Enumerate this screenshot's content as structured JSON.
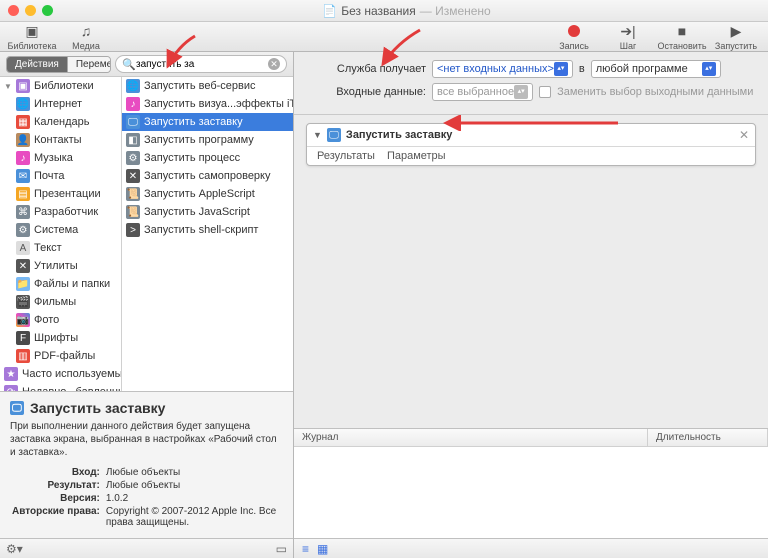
{
  "window": {
    "title": "Без названия",
    "modified": "— Изменено",
    "doc_icon": "📄"
  },
  "toolbar": {
    "left": [
      {
        "name": "library-button",
        "icon": "▣",
        "label": "Библиотека"
      },
      {
        "name": "media-button",
        "icon": "♫",
        "label": "Медиа"
      }
    ],
    "right": [
      {
        "name": "record-button",
        "icon": "●",
        "label": "Запись",
        "red": true
      },
      {
        "name": "step-button",
        "icon": "➔|",
        "label": "Шаг"
      },
      {
        "name": "stop-button",
        "icon": "■",
        "label": "Остановить"
      },
      {
        "name": "run-button",
        "icon": "▶",
        "label": "Запустить"
      }
    ]
  },
  "segments": {
    "actions": "Действия",
    "variables": "Переменные"
  },
  "search": {
    "icon": "🔍",
    "value": "запустить за"
  },
  "categories_header": "Библиотеки",
  "categories": [
    {
      "label": "Интернет",
      "ic": "i-globe",
      "g": "🌐"
    },
    {
      "label": "Календарь",
      "ic": "i-cal",
      "g": "▦"
    },
    {
      "label": "Контакты",
      "ic": "i-cont",
      "g": "👤"
    },
    {
      "label": "Музыка",
      "ic": "i-music",
      "g": "♪"
    },
    {
      "label": "Почта",
      "ic": "i-mail",
      "g": "✉"
    },
    {
      "label": "Презентации",
      "ic": "i-pres",
      "g": "▤"
    },
    {
      "label": "Разработчик",
      "ic": "i-dev",
      "g": "⌘"
    },
    {
      "label": "Система",
      "ic": "i-sys",
      "g": "⚙"
    },
    {
      "label": "Текст",
      "ic": "i-text",
      "g": "A"
    },
    {
      "label": "Утилиты",
      "ic": "i-util",
      "g": "✕"
    },
    {
      "label": "Файлы и папки",
      "ic": "i-folder",
      "g": "📁"
    },
    {
      "label": "Фильмы",
      "ic": "i-film",
      "g": "🎬"
    },
    {
      "label": "Фото",
      "ic": "i-photo",
      "g": "📷"
    },
    {
      "label": "Шрифты",
      "ic": "i-font",
      "g": "F"
    },
    {
      "label": "PDF-файлы",
      "ic": "i-pdf",
      "g": "▥"
    }
  ],
  "categories_footer": [
    {
      "label": "Часто используемые",
      "ic": "i-recent",
      "g": "★"
    },
    {
      "label": "Недавно...бавленные",
      "ic": "i-recent",
      "g": "⟳"
    }
  ],
  "actions": [
    {
      "label": "Запустить веб-сервис",
      "ic": "i-globe",
      "g": "🌐"
    },
    {
      "label": "Запустить визуа...эффекты iTunes",
      "ic": "i-music",
      "g": "♪"
    },
    {
      "label": "Запустить заставку",
      "ic": "i-ss",
      "g": "🖵",
      "sel": true
    },
    {
      "label": "Запустить программу",
      "ic": "i-app",
      "g": "◧"
    },
    {
      "label": "Запустить процесс",
      "ic": "i-dev",
      "g": "⚙"
    },
    {
      "label": "Запустить самопроверку",
      "ic": "i-util",
      "g": "✕"
    },
    {
      "label": "Запустить AppleScript",
      "ic": "i-dev",
      "g": "📜"
    },
    {
      "label": "Запустить JavaScript",
      "ic": "i-dev",
      "g": "📜"
    },
    {
      "label": "Запустить shell-скрипт",
      "ic": "i-util",
      "g": ">"
    }
  ],
  "info": {
    "title": "Запустить заставку",
    "desc": "При выполнении данного действия будет запущена заставка экрана, выбранная в настройках «Рабочий стол и заставка».",
    "rows": {
      "input_k": "Вход:",
      "input_v": "Любые объекты",
      "result_k": "Результат:",
      "result_v": "Любые объекты",
      "version_k": "Версия:",
      "version_v": "1.0.2",
      "copy_k": "Авторские права:",
      "copy_v": "Copyright © 2007-2012 Apple Inc. Все права защищены."
    }
  },
  "options": {
    "receives_label": "Служба получает",
    "receives_value": "<нет входных данных>",
    "in_label": "в",
    "in_value": "любой программе",
    "input_label": "Входные данные:",
    "input_value": "все выбранное",
    "replace_label": "Заменить выбор выходными данными"
  },
  "card": {
    "title": "Запустить заставку",
    "tabs": {
      "results": "Результаты",
      "params": "Параметры"
    }
  },
  "log": {
    "col1": "Журнал",
    "col2": "Длительность"
  }
}
